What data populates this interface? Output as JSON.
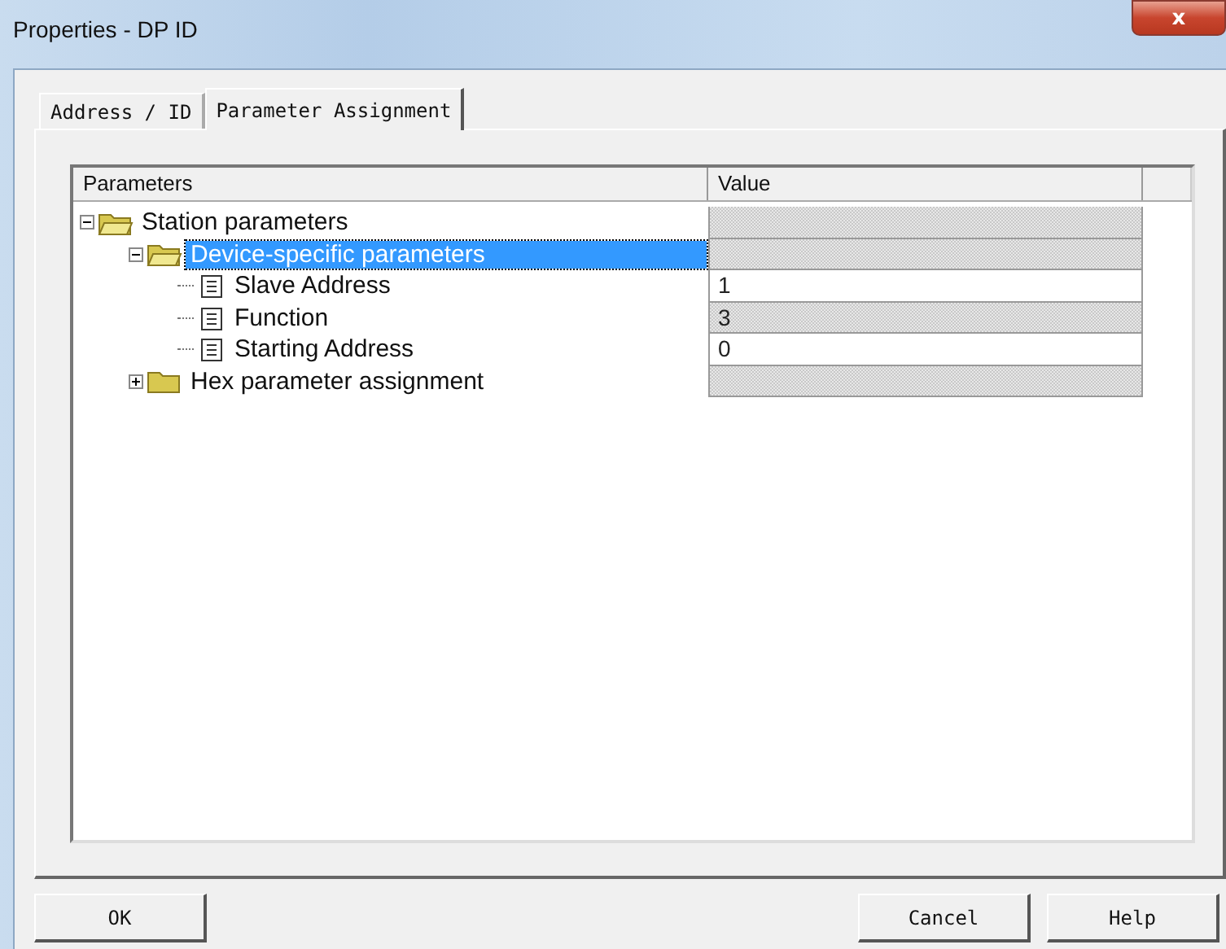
{
  "window": {
    "title": "Properties - DP ID",
    "close": "x"
  },
  "tabs": [
    {
      "label": "Address / ID",
      "selected": false
    },
    {
      "label": "Parameter Assignment",
      "selected": true
    }
  ],
  "table": {
    "columns": [
      "Parameters",
      "Value"
    ],
    "rows": [
      {
        "label": "Station parameters",
        "kind": "folder",
        "expanded": true,
        "selected": false,
        "editable": false,
        "children": [
          {
            "label": "Device-specific parameters",
            "kind": "folder",
            "expanded": true,
            "selected": true,
            "editable": false,
            "children": [
              {
                "label": "Slave Address",
                "kind": "param",
                "selected": false,
                "value": "1",
                "editable": true
              },
              {
                "label": "Function",
                "kind": "param",
                "selected": false,
                "value": "3",
                "editable": false
              },
              {
                "label": "Starting Address",
                "kind": "param",
                "selected": false,
                "value": "0",
                "editable": true
              }
            ]
          },
          {
            "label": "Hex parameter assignment",
            "kind": "folder",
            "expanded": false,
            "selected": false,
            "editable": false
          }
        ]
      }
    ]
  },
  "buttons": [
    "OK",
    "Cancel",
    "Help"
  ]
}
